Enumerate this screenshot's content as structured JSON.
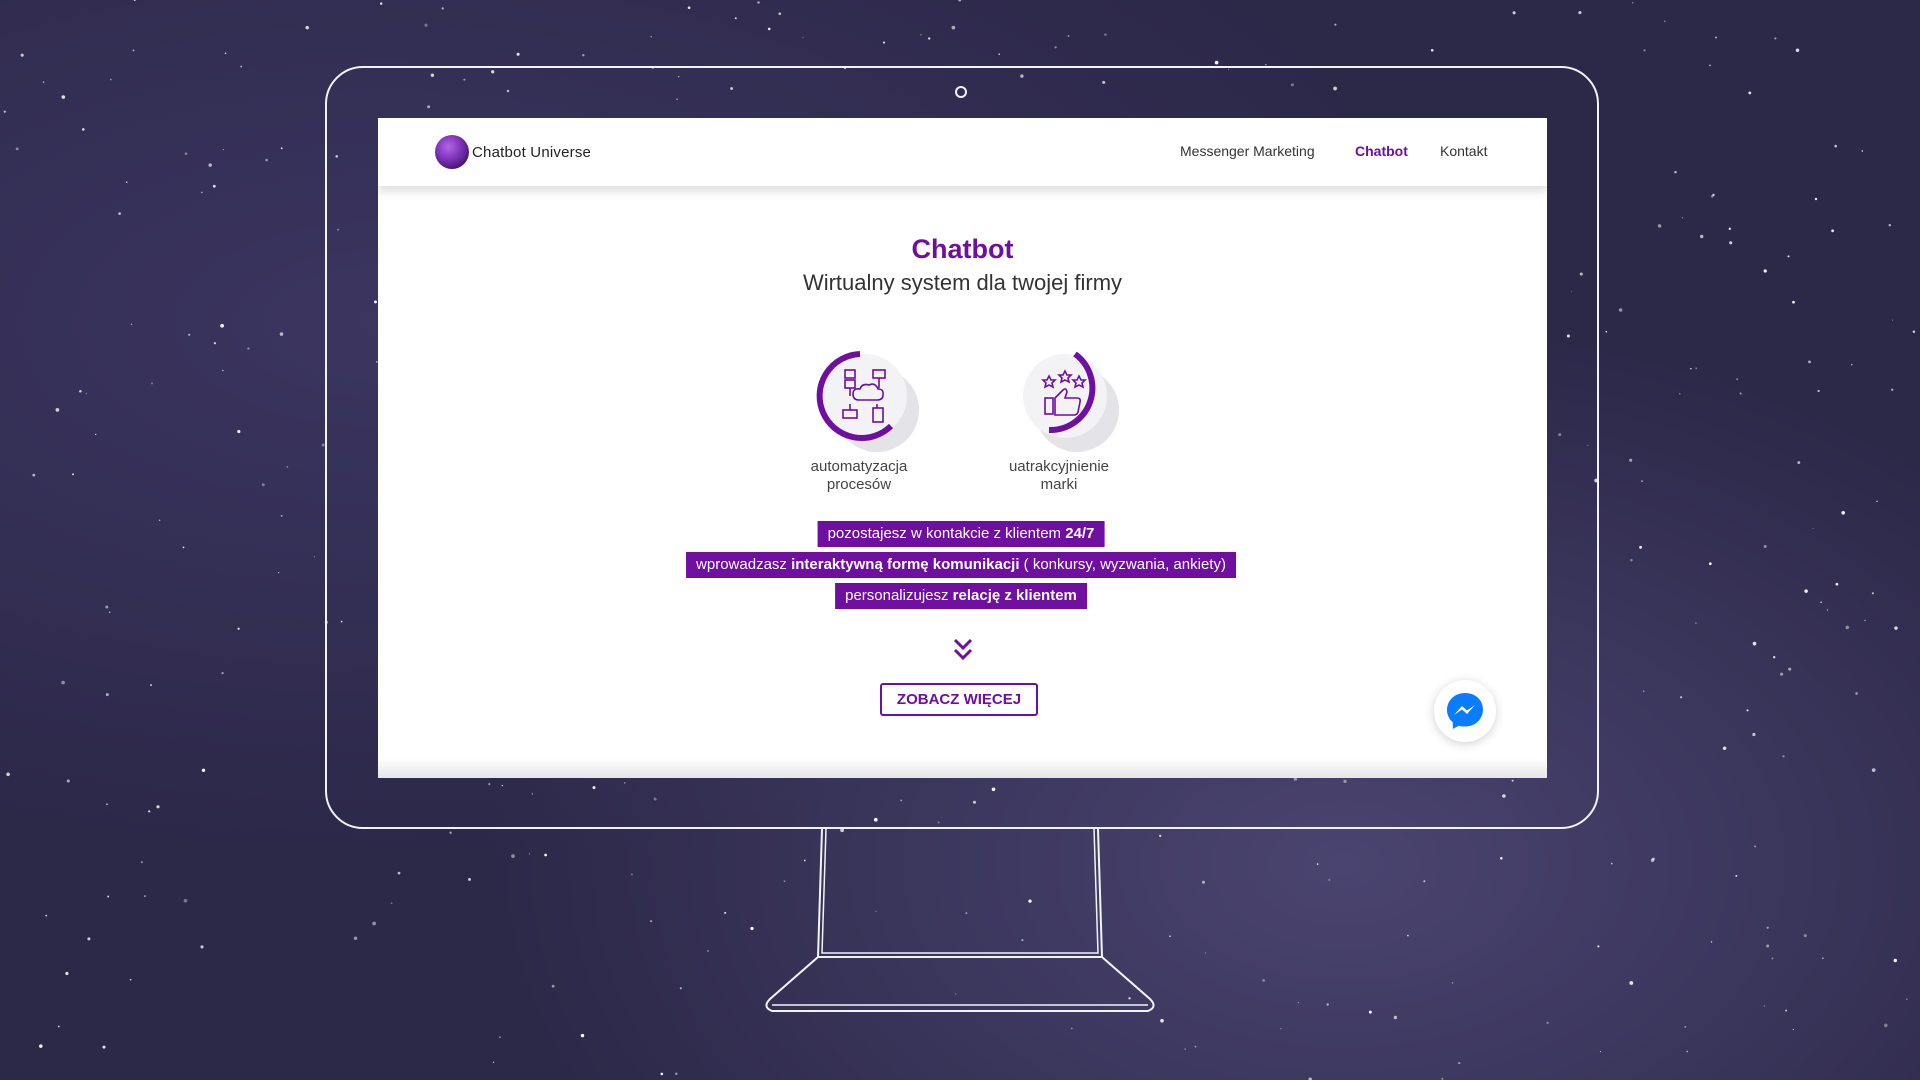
{
  "logo": {
    "text": "Chatbot Universe"
  },
  "nav": {
    "items": [
      {
        "label": "Messenger Marketing"
      },
      {
        "label": "Chatbot",
        "active": true
      },
      {
        "label": "Kontakt"
      }
    ]
  },
  "hero": {
    "title": "Chatbot",
    "subtitle": "Wirtualny system dla twojej firmy"
  },
  "features": [
    {
      "label_line1": "automatyzacja",
      "label_line2": "procesów",
      "icon": "network-cloud-icon"
    },
    {
      "label_line1": "uatrakcyjnienie",
      "label_line2": "marki",
      "icon": "thumbs-up-stars-icon"
    }
  ],
  "benefits": [
    {
      "pre": "pozostajesz w kontakcie z klientem ",
      "bold": "24/7",
      "post": ""
    },
    {
      "pre": "wprowadzasz ",
      "bold": "interaktywną formę komunikacji",
      "post": " ( konkursy, wyzwania, ankiety)"
    },
    {
      "pre": "personalizujesz ",
      "bold": "relację z klientem",
      "post": ""
    }
  ],
  "cta": {
    "label": "ZOBACZ WIĘCEJ"
  },
  "colors": {
    "accent": "#6e0fa0",
    "messenger": "#0a7cff"
  }
}
